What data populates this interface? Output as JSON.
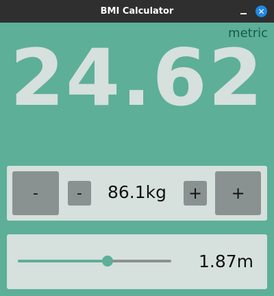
{
  "window": {
    "title": "BMI Calculator",
    "minimize_icon": "minimize-icon",
    "close_icon": "close-icon",
    "close_glyph": "✕"
  },
  "unit_system": "metric",
  "bmi": "24.62",
  "weight": {
    "big_minus_label": "-",
    "small_minus_label": "-",
    "value": "86.1kg",
    "small_plus_label": "+",
    "big_plus_label": "+"
  },
  "height": {
    "value": "1.87m",
    "slider_fraction": 0.585
  },
  "colors": {
    "background": "#5daf98",
    "panel": "#d6e0dc",
    "button": "#8a9291",
    "unit_text": "#155b4c",
    "bmi_text": "#d6e0dc",
    "close_button": "#1e88e5",
    "titlebar": "#2f2f2f"
  }
}
